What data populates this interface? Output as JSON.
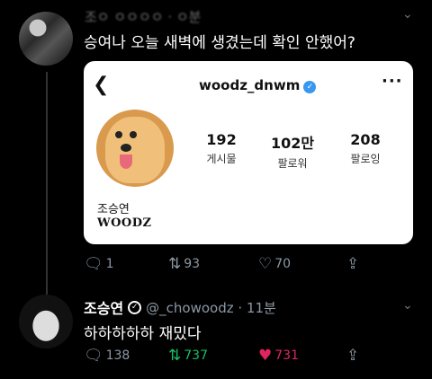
{
  "tweet1": {
    "header": "조ㅇ ㅇㅇㅇㅇ · ㅇ분",
    "text": "승여나 오늘 새벽에 생겼는데 확인 안했어?",
    "card": {
      "username": "woodz_dnwm",
      "stats": [
        {
          "value": "192",
          "label": "게시물"
        },
        {
          "value": "102만",
          "label": "팔로워"
        },
        {
          "value": "208",
          "label": "팔로잉"
        }
      ],
      "real_name": "조승연",
      "bio": "WOODZ"
    },
    "actions": {
      "reply": "1",
      "retweet": "93",
      "like": "70"
    }
  },
  "tweet2": {
    "name": "조승연",
    "handle": "@_chowoodz · 11분",
    "text": "하하하하하 재밌다",
    "actions": {
      "reply": "138",
      "retweet": "737",
      "like": "731"
    }
  },
  "icons": {
    "reply": "reply-icon",
    "retweet": "retweet-icon",
    "like": "heart-icon",
    "share": "share-icon"
  },
  "colors": {
    "retweet_active": "#17bf63",
    "like_active": "#e0245e",
    "verified": "#3897f0"
  }
}
